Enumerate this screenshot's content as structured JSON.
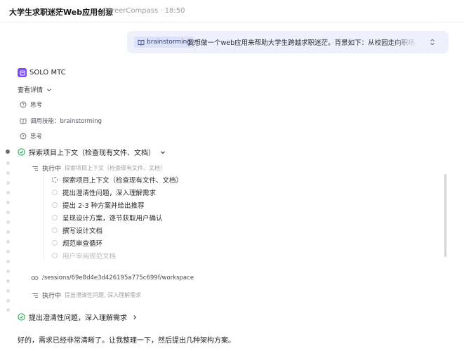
{
  "header": {
    "title": "大学生求职迷茫Web应用创意",
    "subtitle": "CareerCompass · 18:50"
  },
  "user_message": {
    "chip_label": "brainstorming",
    "text": "我想做一个web应用来帮助大学生跨越求职迷茫。背景如下：从校园走向职场,"
  },
  "agent": {
    "name": "SOLO MTC",
    "details_label": "查看详情"
  },
  "activity": {
    "think1": "思考",
    "skill_call": "调用技能：brainstorming",
    "think2": "思考"
  },
  "step1": {
    "title": "探索项目上下文（检查现有文件、文档）",
    "exec_key": "执行中",
    "exec_value": "探索项目上下文（检查现有文件、文档）"
  },
  "tasks": [
    "探索项目上下文（检查现有文件、文档）",
    "提出澄清性问题，深入理解需求",
    "提出 2-3 种方案并给出推荐",
    "呈现设计方案，逐节获取用户确认",
    "撰写设计文档",
    "规范审查循环",
    "用户审阅规范文档"
  ],
  "workspace_path": "/sessions/69e8d4e3d426195a775c699f/workspace",
  "exec2": {
    "key": "执行中",
    "value": "提出澄清性问题, 深入理解需求"
  },
  "step2": {
    "title": "提出澄清性问题，深入理解需求"
  },
  "final_text": "好的，需求已经非常清晰了。让我整理一下，然后提出几种架构方案。",
  "icons": {
    "book": "book-icon",
    "chevron": "chevron-down-icon",
    "think": "think-icon",
    "check": "check-circle-icon",
    "list": "list-icon",
    "link": "link-icon",
    "expand": "expand-icon"
  },
  "colors": {
    "accent": "#7e4cf0",
    "success": "#1aa34a",
    "bubble": "#eef0fb"
  }
}
